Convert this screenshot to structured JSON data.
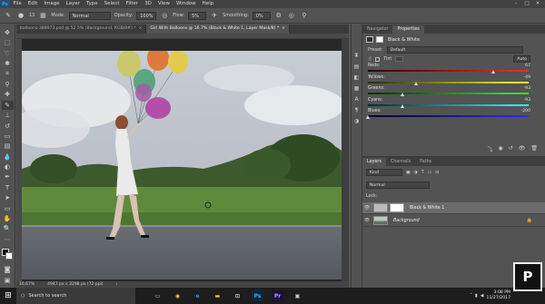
{
  "menubar": {
    "app_logo": "Ps",
    "items": [
      "File",
      "Edit",
      "Image",
      "Layer",
      "Type",
      "Select",
      "Filter",
      "3D",
      "View",
      "Window",
      "Help"
    ]
  },
  "options": {
    "brush_size": "13",
    "mode_label": "Mode:",
    "mode_value": "Normal",
    "opacity_label": "Opacity:",
    "opacity_value": "100%",
    "flow_label": "Flow:",
    "flow_value": "5%",
    "smoothing_label": "Smoothing:",
    "smoothing_value": "0%"
  },
  "tabs": [
    {
      "label": "balloons-388973.psd @ 52.5% (Background, RGB/8#) *",
      "close": "×"
    },
    {
      "label": "Girl With Balloons @ 16.7% (Black & White 1, Layer Mask/8) *",
      "close": "×"
    }
  ],
  "status": {
    "zoom": "16.67%",
    "doc_size": "4947 px x 3298 px (72 ppi)"
  },
  "properties": {
    "tabs": [
      "Navigator",
      "Properties"
    ],
    "adjustment_title": "Black & White",
    "preset_label": "Preset:",
    "preset_value": "Default",
    "tint_label": "Tint",
    "auto_label": "Auto",
    "sliders": [
      {
        "label": "Reds:",
        "value": "67",
        "pos": 0.78,
        "gradient": "linear-gradient(90deg,#2a0000,#ff2a2a)"
      },
      {
        "label": "Yellows:",
        "value": "-49",
        "pos": 0.3,
        "gradient": "linear-gradient(90deg,#2a2a00,#ffff2a)"
      },
      {
        "label": "Greens:",
        "value": "-93",
        "pos": 0.22,
        "gradient": "linear-gradient(90deg,#002a00,#2aff2a)"
      },
      {
        "label": "Cyans:",
        "value": "-93",
        "pos": 0.22,
        "gradient": "linear-gradient(90deg,#002a2a,#2affff)"
      },
      {
        "label": "Blues:",
        "value": "-200",
        "pos": 0.0,
        "gradient": "linear-gradient(90deg,#00002a,#2a2aff)"
      }
    ]
  },
  "layers": {
    "tabs": [
      "Layers",
      "Channels",
      "Paths"
    ],
    "filter_kind": "Kind",
    "blend_mode": "Normal",
    "lock_label": "Lock:",
    "rows": [
      {
        "name": "Black & White 1",
        "selected": true
      },
      {
        "name": "Background",
        "selected": false
      }
    ]
  },
  "taskbar": {
    "search_placeholder": "Search to search",
    "clock_time": "3:08 PM",
    "clock_date": "11/27/2017",
    "logo": "P"
  },
  "colors": {
    "accent": "#31a8ff",
    "panel_bg": "#535353",
    "dark_bg": "#282828"
  }
}
